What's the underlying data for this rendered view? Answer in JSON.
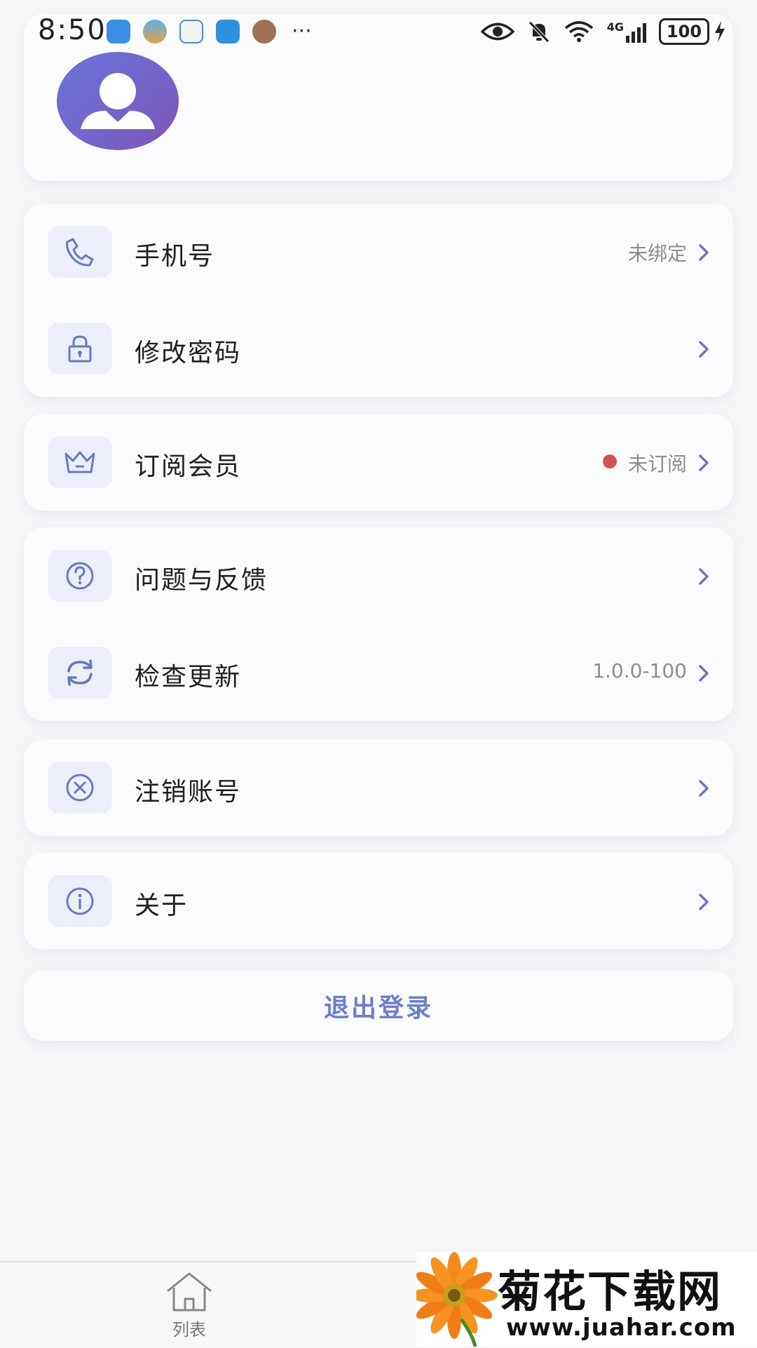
{
  "status_bar": {
    "time": "8:50",
    "overflow": "···",
    "network": "4G",
    "battery": "100"
  },
  "profile": {
    "avatar_icon": "user-avatar-icon"
  },
  "groups": [
    {
      "rows": [
        {
          "icon": "phone-icon",
          "label": "手机号",
          "value": "未绑定"
        },
        {
          "icon": "lock-icon",
          "label": "修改密码",
          "value": ""
        }
      ]
    },
    {
      "rows": [
        {
          "icon": "crown-icon",
          "label": "订阅会员",
          "value": "未订阅",
          "dot_color": "#d94f4f"
        }
      ]
    },
    {
      "rows": [
        {
          "icon": "question-icon",
          "label": "问题与反馈",
          "value": ""
        },
        {
          "icon": "refresh-icon",
          "label": "检查更新",
          "value": "1.0.0-100"
        }
      ]
    },
    {
      "rows": [
        {
          "icon": "cancel-circle-icon",
          "label": "注销账号",
          "value": ""
        }
      ]
    },
    {
      "rows": [
        {
          "icon": "info-icon",
          "label": "关于",
          "value": ""
        }
      ]
    }
  ],
  "logout": {
    "label": "退出登录"
  },
  "tabbar": {
    "items": [
      {
        "icon": "home-icon",
        "label": "列表"
      }
    ]
  },
  "watermark": {
    "title": "菊花下载网",
    "url": "www.juahar.com"
  },
  "colors": {
    "accent": "#6e7dcc",
    "icon": "#6878c4",
    "icon_bg": "#eceef9",
    "dot": "#d94f4f"
  }
}
